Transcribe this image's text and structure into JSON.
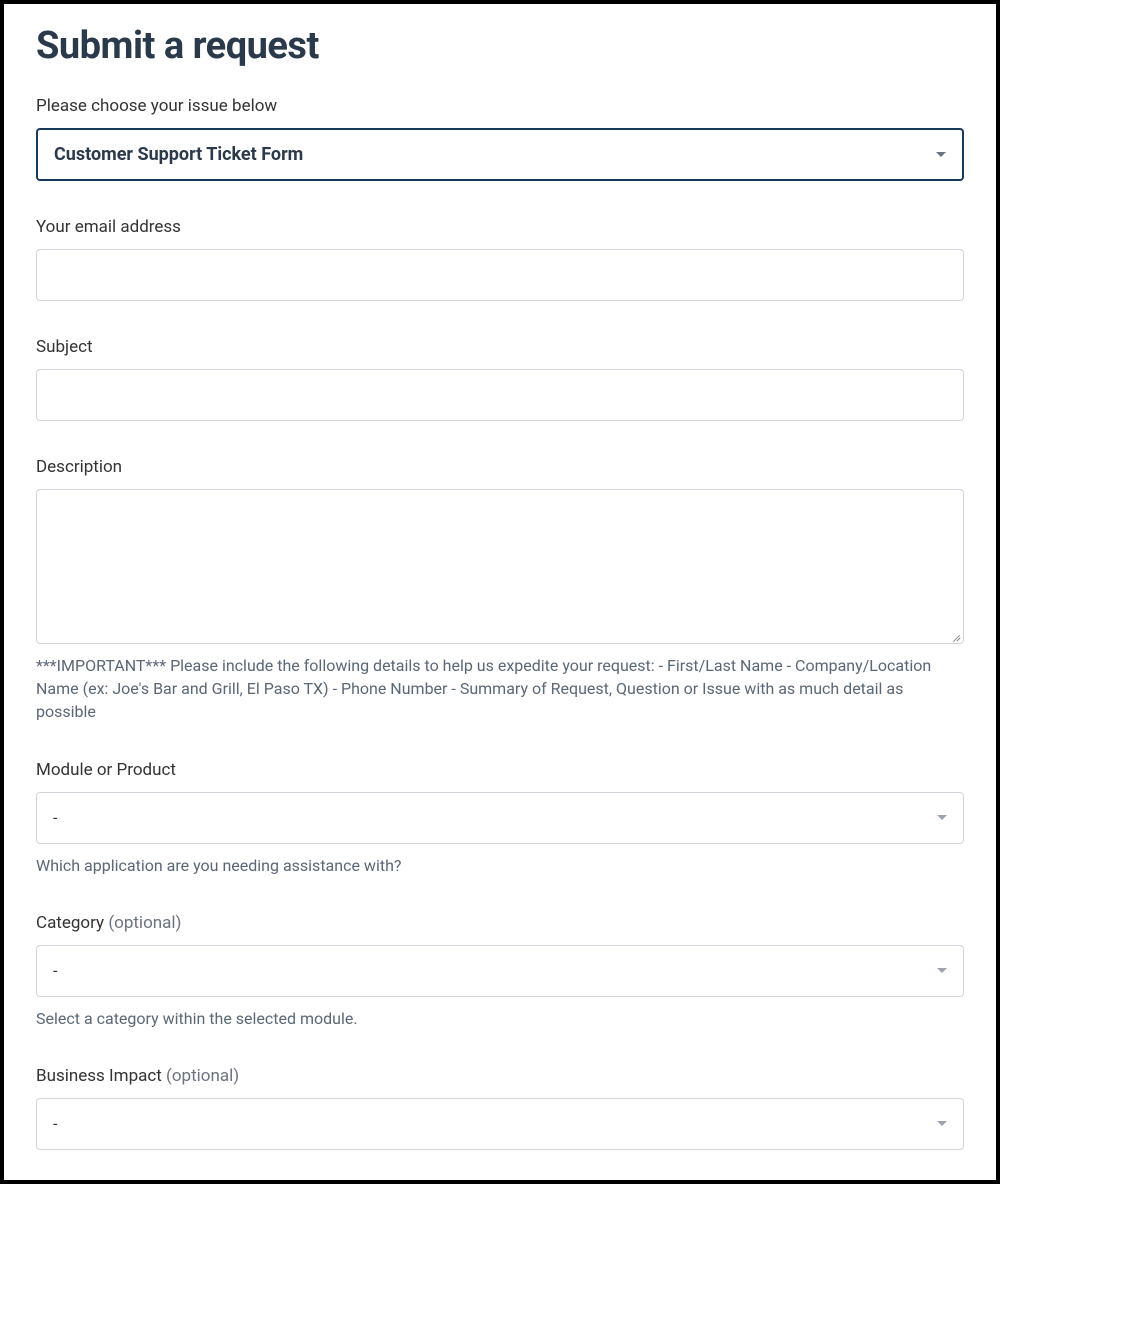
{
  "page": {
    "title": "Submit a request"
  },
  "fields": {
    "issue": {
      "label": "Please choose your issue below",
      "value": "Customer Support Ticket Form"
    },
    "email": {
      "label": "Your email address",
      "value": ""
    },
    "subject": {
      "label": "Subject",
      "value": ""
    },
    "description": {
      "label": "Description",
      "value": "",
      "help": "***IMPORTANT*** Please include the following details to help us expedite your request: - First/Last Name - Company/Location Name (ex: Joe's Bar and Grill, El Paso TX) - Phone Number - Summary of Request, Question or Issue with as much detail as possible"
    },
    "module": {
      "label": "Module or Product",
      "value": "-",
      "help": "Which application are you needing assistance with?"
    },
    "category": {
      "label": "Category",
      "optional": "(optional)",
      "value": "-",
      "help": "Select a category within the selected module."
    },
    "impact": {
      "label": "Business Impact",
      "optional": "(optional)",
      "value": "-"
    }
  }
}
